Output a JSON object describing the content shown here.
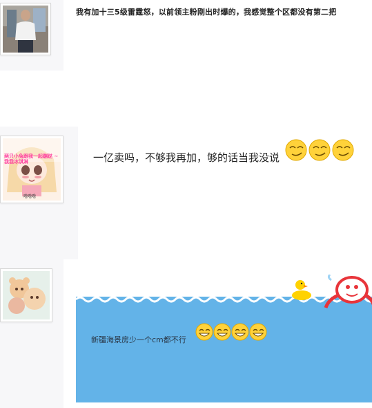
{
  "posts": [
    {
      "text": "我有加十三5级雷霆怒，以前领主粉刚出时爆的，我感觉整个区都没有第二把",
      "emoji_count": 0
    },
    {
      "text": "一亿卖吗，不够我再加，够的话当我没说",
      "avatar_caption": "噜噜噜",
      "avatar_overlay_text": "两只小兔跟我一起蹦跶 ~ 我我冰淇淋",
      "emoji_count": 3
    },
    {
      "text": "新疆海景房少一个cm都不行",
      "emoji_count": 4
    }
  ],
  "icons": {
    "post1_avatar": "person-photo-icon",
    "post2_avatar": "anime-girl-icon",
    "post3_avatar": "cartoon-bear-icon",
    "emoji_smirk": "smirk-face-icon",
    "emoji_grin": "grin-face-icon",
    "duck": "rubber-duck-icon",
    "crab": "red-crab-icon"
  },
  "colors": {
    "sea_blue": "#63b3e8",
    "wave_blue": "#4a9fd8",
    "emoji_yellow": "#ffd23a",
    "crab_red": "#e8343a",
    "duck_yellow": "#ffd200"
  }
}
